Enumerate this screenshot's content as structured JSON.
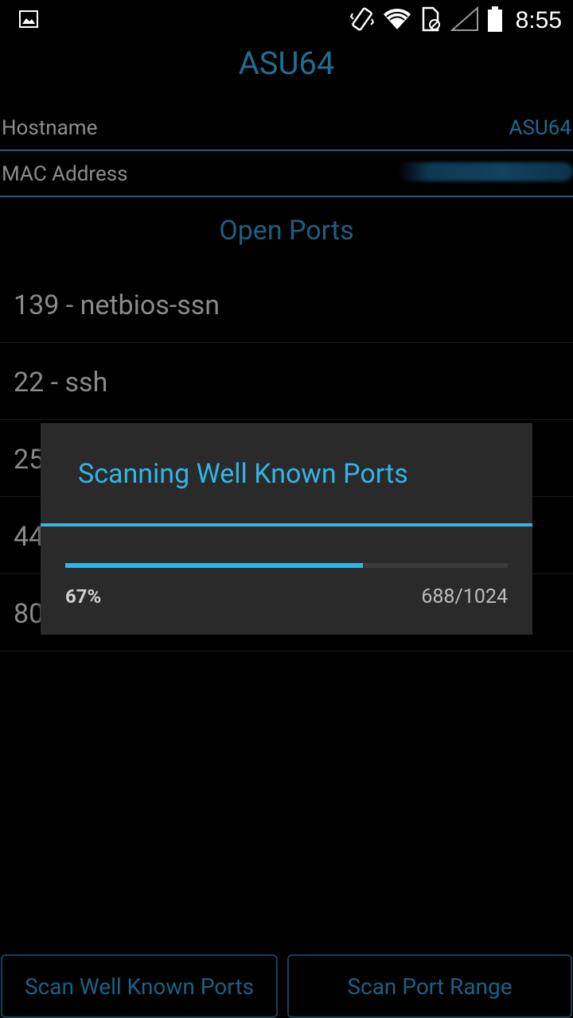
{
  "status_bar": {
    "time": "8:55",
    "icons": [
      "image-icon",
      "vibrate-icon",
      "wifi-icon",
      "sd-card-icon",
      "signal-icon",
      "battery-icon"
    ]
  },
  "app": {
    "title": "ASU64"
  },
  "info": {
    "hostname_label": "Hostname",
    "hostname_value": "ASU64",
    "mac_label": "MAC Address",
    "mac_value": ""
  },
  "ports": {
    "section_title": "Open Ports",
    "items": [
      {
        "label": "139 - netbios-ssn"
      },
      {
        "label": "22 - ssh"
      },
      {
        "label": "25"
      },
      {
        "label": "44"
      },
      {
        "label": "80"
      }
    ]
  },
  "dialog": {
    "title": "Scanning Well Known Ports",
    "progress_fraction": 0.672,
    "percent_text": "67%",
    "count_text": "688/1024"
  },
  "buttons": {
    "scan_well_known": "Scan Well Known Ports",
    "scan_port_range": "Scan Port Range"
  },
  "colors": {
    "accent": "#33b5e5",
    "title_blue": "#1d6f93",
    "background": "#000000",
    "dialog_bg": "#2a2a2a"
  }
}
